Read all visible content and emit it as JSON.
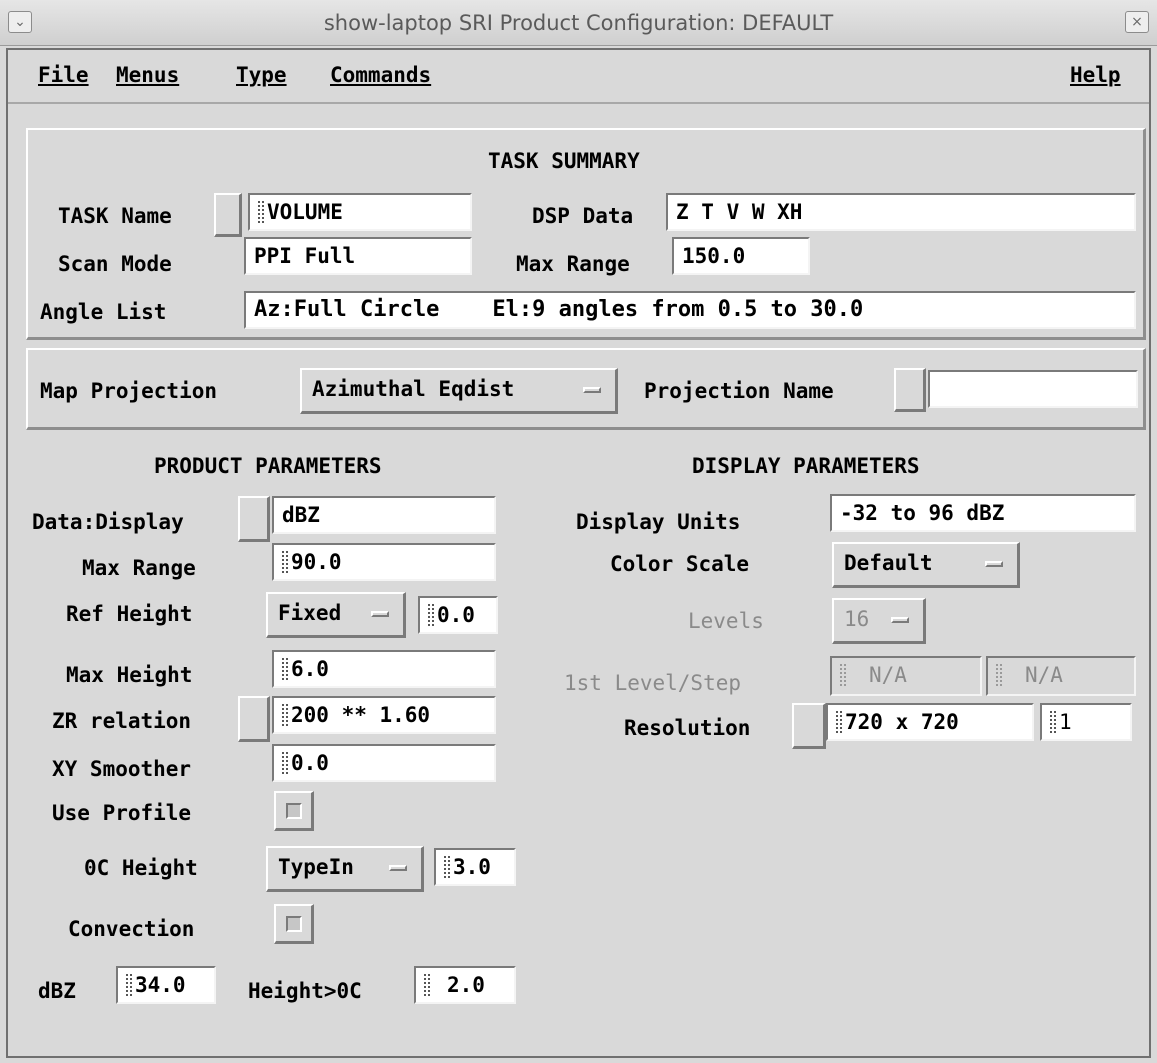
{
  "window": {
    "title": "show-laptop  SRI Product Configuration: DEFAULT",
    "collapse_glyph": "⌄",
    "close_glyph": "×"
  },
  "menubar": {
    "file": "File",
    "menus": "Menus",
    "type": "Type",
    "commands": "Commands",
    "help": "Help"
  },
  "task_summary": {
    "heading": "TASK SUMMARY",
    "task_name_label": "TASK Name",
    "task_name_value": "VOLUME",
    "dsp_data_label": "DSP Data",
    "dsp_data_value": "Z T V W XH",
    "scan_mode_label": "Scan Mode",
    "scan_mode_value": "PPI Full",
    "max_range_label": "Max Range",
    "max_range_value": "150.0",
    "angle_list_label": "Angle List",
    "angle_list_value": "Az:Full Circle    El:9 angles from 0.5 to 30.0"
  },
  "map": {
    "projection_label": "Map Projection",
    "projection_value": "Azimuthal Eqdist",
    "projection_name_label": "Projection Name",
    "projection_name_value": ""
  },
  "product": {
    "heading": "PRODUCT PARAMETERS",
    "data_display_label": "Data:Display",
    "data_display_value": "dBZ",
    "max_range_label": "Max Range",
    "max_range_value": "90.0",
    "ref_height_label": "Ref Height",
    "ref_height_mode": "Fixed",
    "ref_height_value": "0.0",
    "max_height_label": "Max Height",
    "max_height_value": "6.0",
    "zr_label": "ZR relation",
    "zr_value": "200 ** 1.60",
    "xy_smoother_label": "XY Smoother",
    "xy_smoother_value": "0.0",
    "use_profile_label": "Use Profile",
    "oc_height_label": "0C Height",
    "oc_height_mode": "TypeIn",
    "oc_height_value": "3.0",
    "convection_label": "Convection",
    "dbz_label": "dBZ",
    "dbz_value": "34.0",
    "height_oc_label": "Height>0C",
    "height_oc_value": "2.0"
  },
  "display": {
    "heading": "DISPLAY PARAMETERS",
    "units_label": "Display Units",
    "units_value": "-32 to 96 dBZ",
    "color_scale_label": "Color Scale",
    "color_scale_value": "Default",
    "levels_label": "Levels",
    "levels_value": "16",
    "first_level_label": "1st Level/Step",
    "first_level_value": "N/A",
    "step_value": "N/A",
    "resolution_label": "Resolution",
    "resolution_value": "720 x 720",
    "resolution_factor": "1"
  }
}
